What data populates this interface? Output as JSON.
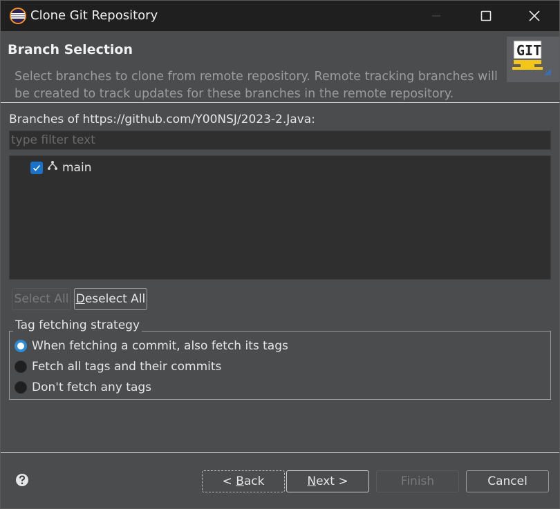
{
  "window": {
    "title": "Clone Git Repository"
  },
  "header": {
    "title": "Branch Selection",
    "description": "Select branches to clone from remote repository. Remote tracking branches will be created to track updates for these branches in the remote repository.",
    "logo_text": "GIT"
  },
  "branches": {
    "label": "Branches of https://github.com/Y00NSJ/2023-2.Java:",
    "filter_placeholder": "type filter text",
    "filter_value": "",
    "items": [
      {
        "label": "main",
        "checked": true
      }
    ],
    "select_all_label": "Select All",
    "deselect_all_prefix": "D",
    "deselect_all_rest": "eselect All"
  },
  "tags": {
    "group_title": "Tag fetching strategy",
    "options": [
      {
        "label": "When fetching a commit, also fetch its tags",
        "selected": true
      },
      {
        "label": "Fetch all tags and their commits",
        "selected": false
      },
      {
        "label": "Don't fetch any tags",
        "selected": false
      }
    ]
  },
  "footer": {
    "back_prefix": "< ",
    "back_key": "B",
    "back_rest": "ack",
    "next_key": "N",
    "next_rest": "ext >",
    "finish_label": "Finish",
    "cancel_label": "Cancel"
  },
  "colors": {
    "accent": "#1a73c8",
    "background": "#4a4c4e",
    "titlebar": "#1f1f1f"
  }
}
